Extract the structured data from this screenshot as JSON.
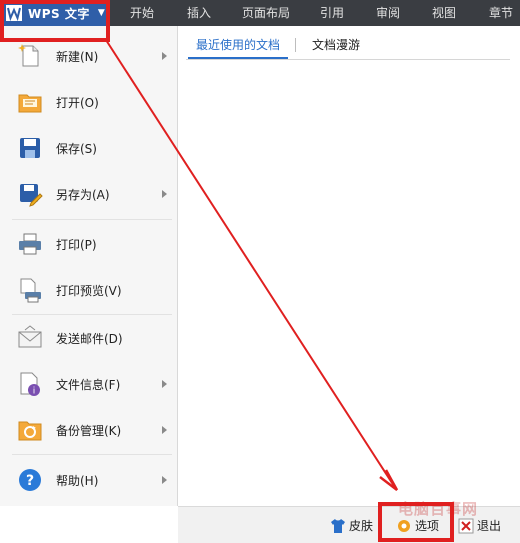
{
  "app": {
    "title": "WPS 文字"
  },
  "ribbon_tabs": [
    "开始",
    "插入",
    "页面布局",
    "引用",
    "审阅",
    "视图",
    "章节"
  ],
  "menu": [
    {
      "label": "新建(N)",
      "icon": "new-document-icon",
      "has_submenu": true
    },
    {
      "label": "打开(O)",
      "icon": "open-folder-icon",
      "has_submenu": false
    },
    {
      "label": "保存(S)",
      "icon": "save-icon",
      "has_submenu": false
    },
    {
      "label": "另存为(A)",
      "icon": "save-as-icon",
      "has_submenu": true
    },
    {
      "label": "打印(P)",
      "icon": "printer-icon",
      "has_submenu": false
    },
    {
      "label": "打印预览(V)",
      "icon": "print-preview-icon",
      "has_submenu": false
    },
    {
      "label": "发送邮件(D)",
      "icon": "mail-icon",
      "has_submenu": false
    },
    {
      "label": "文件信息(F)",
      "icon": "file-info-icon",
      "has_submenu": true
    },
    {
      "label": "备份管理(K)",
      "icon": "backup-icon",
      "has_submenu": true
    },
    {
      "label": "帮助(H)",
      "icon": "help-icon",
      "has_submenu": true
    }
  ],
  "doc_tabs": [
    {
      "label": "最近使用的文档",
      "active": true
    },
    {
      "label": "文档漫游",
      "active": false
    }
  ],
  "bottom": {
    "skin": "皮肤",
    "options": "选项",
    "exit": "退出"
  },
  "watermark": "电脑百事网",
  "colors": {
    "accent": "#2a6fc9",
    "highlight": "#e02020",
    "titlebar": "#3a3d42",
    "app_button": "#2f5ea8"
  }
}
